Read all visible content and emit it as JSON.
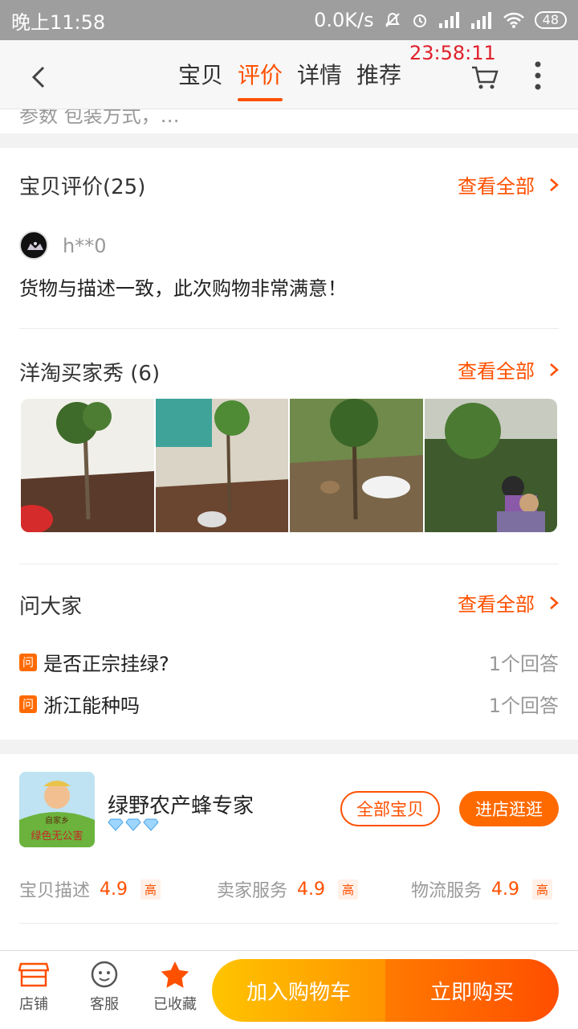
{
  "status_bar": {
    "time": "晚上11:58",
    "network_speed": "0.0K/s",
    "battery": "48"
  },
  "clock_overlay": "23:58:11",
  "header": {
    "tabs": [
      {
        "label": "宝贝",
        "active": false
      },
      {
        "label": "评价",
        "active": true
      },
      {
        "label": "详情",
        "active": false
      },
      {
        "label": "推荐",
        "active": false
      }
    ],
    "accent_color": "#ff5000"
  },
  "partial_row": "参数   包装方式，…",
  "reviews": {
    "title": "宝贝评价(25)",
    "see_all": "查看全部",
    "first_review": {
      "user": "h**0",
      "text": "货物与描述一致，此次购物非常满意！"
    }
  },
  "buyer_show": {
    "title": "洋淘买家秀 (6)",
    "see_all": "查看全部"
  },
  "ask_all": {
    "title": "问大家",
    "see_all": "查看全部",
    "badge": "问",
    "questions": [
      {
        "question": "是否正宗挂绿?",
        "answers": "1个回答"
      },
      {
        "question": "浙江能种吗",
        "answers": "1个回答"
      }
    ]
  },
  "shop": {
    "name": "绿野农产蜂专家",
    "logo_text": {
      "top": "自家乡",
      "bottom": "绿色无公害"
    },
    "all_items_button": "全部宝贝",
    "visit_button": "进店逛逛",
    "ratings": [
      {
        "label": "宝贝描述",
        "value": "4.9",
        "level": "高"
      },
      {
        "label": "卖家服务",
        "value": "4.9",
        "level": "高"
      },
      {
        "label": "物流服务",
        "value": "4.9",
        "level": "高"
      }
    ]
  },
  "bottom_bar": {
    "store": "店铺",
    "service": "客服",
    "favorite": "已收藏",
    "add_to_cart": "加入购物车",
    "buy_now": "立即购买"
  }
}
